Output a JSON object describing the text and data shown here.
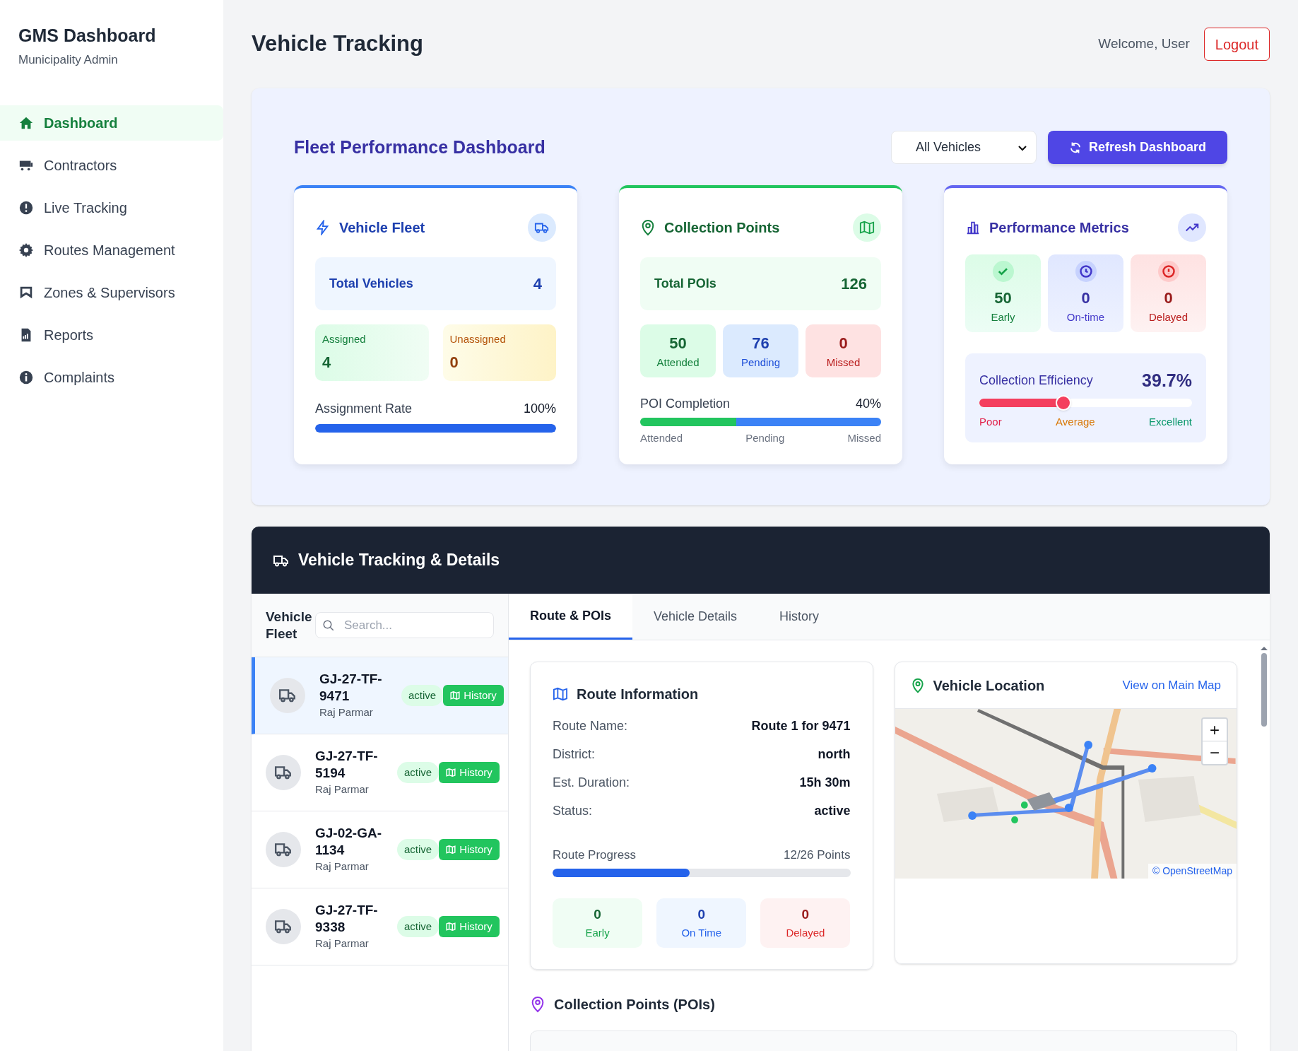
{
  "sidebar": {
    "title": "GMS Dashboard",
    "subtitle": "Municipality Admin",
    "items": [
      {
        "label": "Dashboard",
        "selected": true
      },
      {
        "label": "Contractors",
        "selected": false
      },
      {
        "label": "Live Tracking",
        "selected": false
      },
      {
        "label": "Routes Management",
        "selected": false
      },
      {
        "label": "Zones & Supervisors",
        "selected": false
      },
      {
        "label": "Reports",
        "selected": false
      },
      {
        "label": "Complaints",
        "selected": false
      }
    ]
  },
  "header": {
    "title": "Vehicle Tracking",
    "welcome": "Welcome, User",
    "logout": "Logout"
  },
  "fleet_dashboard": {
    "title": "Fleet Performance Dashboard",
    "vehicle_select": "All Vehicles",
    "refresh_button": "Refresh Dashboard",
    "vehicle_fleet": {
      "title": "Vehicle Fleet",
      "total_label": "Total Vehicles",
      "total": "4",
      "assigned_label": "Assigned",
      "assigned": "4",
      "unassigned_label": "Unassigned",
      "unassigned": "0",
      "rate_label": "Assignment Rate",
      "rate": "100%",
      "level": 1
    },
    "collection_points": {
      "title": "Collection Points",
      "total_label": "Total POIs",
      "total": "126",
      "stats": [
        {
          "value": "50",
          "label": "Attended",
          "kind": "green"
        },
        {
          "value": "76",
          "label": "Pending",
          "kind": "blue"
        },
        {
          "value": "0",
          "label": "Missed",
          "kind": "red"
        }
      ],
      "completion_label": "POI Completion",
      "completion": "40%",
      "segments": [
        {
          "level": 0.4,
          "color": "#22c55e"
        },
        {
          "level": 0.6,
          "color": "#3b82f6"
        }
      ],
      "legend": [
        "Attended",
        "Pending",
        "Missed"
      ]
    },
    "performance_metrics": {
      "title": "Performance Metrics",
      "stats": [
        {
          "value": "50",
          "label": "Early",
          "kind": "green"
        },
        {
          "value": "0",
          "label": "On-time",
          "kind": "indigo"
        },
        {
          "value": "0",
          "label": "Delayed",
          "kind": "red"
        }
      ],
      "efficiency_label": "Collection Efficiency",
      "efficiency": "39.7%",
      "level": 0.397,
      "scale": [
        "Poor",
        "Average",
        "Excellent"
      ]
    }
  },
  "tracking": {
    "title": "Vehicle Tracking & Details",
    "fleet_label": "Vehicle Fleet",
    "search_placeholder": "Search...",
    "vehicles": [
      {
        "plate": "GJ-27-TF-9471",
        "driver": "Raj Parmar",
        "status": "active",
        "history": "History",
        "selected": true
      },
      {
        "plate": "GJ-27-TF-5194",
        "driver": "Raj Parmar",
        "status": "active",
        "history": "History",
        "selected": false
      },
      {
        "plate": "GJ-02-GA-1134",
        "driver": "Raj Parmar",
        "status": "active",
        "history": "History",
        "selected": false
      },
      {
        "plate": "GJ-27-TF-9338",
        "driver": "Raj Parmar",
        "status": "active",
        "history": "History",
        "selected": false
      }
    ],
    "tabs": [
      {
        "label": "Route & POIs",
        "selected": true
      },
      {
        "label": "Vehicle Details",
        "selected": false
      },
      {
        "label": "History",
        "selected": false
      }
    ],
    "route_info": {
      "title": "Route Information",
      "fields": [
        {
          "label": "Route Name:",
          "value": "Route 1 for 9471"
        },
        {
          "label": "District:",
          "value": "north"
        },
        {
          "label": "Est. Duration:",
          "value": "15h 30m"
        },
        {
          "label": "Status:",
          "value": "active"
        }
      ],
      "progress_label": "Route Progress",
      "progress_text": "12/26 Points",
      "level": 0.46,
      "stats": [
        {
          "value": "0",
          "label": "Early",
          "kind": "green"
        },
        {
          "value": "0",
          "label": "On Time",
          "kind": "blue"
        },
        {
          "value": "0",
          "label": "Delayed",
          "kind": "red"
        }
      ]
    },
    "vehicle_location": {
      "title": "Vehicle Location",
      "link": "View on Main Map",
      "zoom_in": "+",
      "zoom_out": "−",
      "attribution": "© OpenStreetMap"
    },
    "poi_title": "Collection Points (POIs)"
  }
}
